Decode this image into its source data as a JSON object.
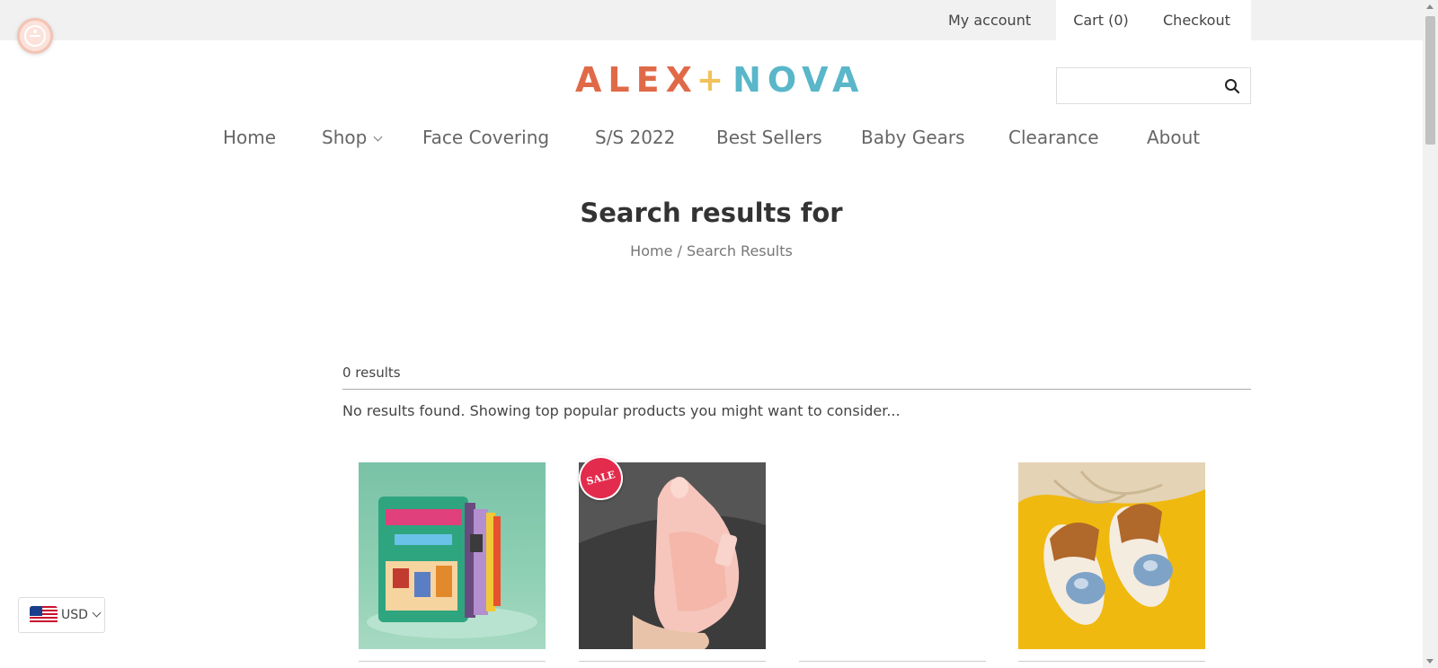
{
  "topbar": {
    "my_account": "My account",
    "cart": "Cart (0)",
    "checkout": "Checkout"
  },
  "logo": {
    "left": "ALEX",
    "plus": "+",
    "right": "NOVA",
    "colors": {
      "left": "#e06a48",
      "plus": "#f1c25a",
      "right": "#5ab6c9"
    }
  },
  "search": {
    "placeholder": "",
    "value": "",
    "icon": "search-icon"
  },
  "nav": {
    "items": [
      {
        "label": "Home"
      },
      {
        "label": "Shop"
      },
      {
        "label": "Face Covering"
      },
      {
        "label": "S/S 2022"
      },
      {
        "label": "Best Sellers"
      },
      {
        "label": "Baby Gears"
      },
      {
        "label": "Clearance"
      },
      {
        "label": "About"
      }
    ]
  },
  "page": {
    "title": "Search results for",
    "breadcrumb_home": "Home",
    "breadcrumb_sep": " / ",
    "breadcrumb_current": "Search Results"
  },
  "results": {
    "count": "0 results",
    "message": "No results found. Showing top popular products you might want to consider..."
  },
  "products": [
    {
      "image": "quiet-book"
    },
    {
      "image": "pink-baby-shoe",
      "badge": "SALE"
    },
    {
      "image": "blank"
    },
    {
      "image": "denim-sandals"
    }
  ],
  "currency": {
    "code": "USD",
    "flag": "us-flag-icon"
  },
  "accessibility": {
    "icon": "accessibility-icon"
  }
}
